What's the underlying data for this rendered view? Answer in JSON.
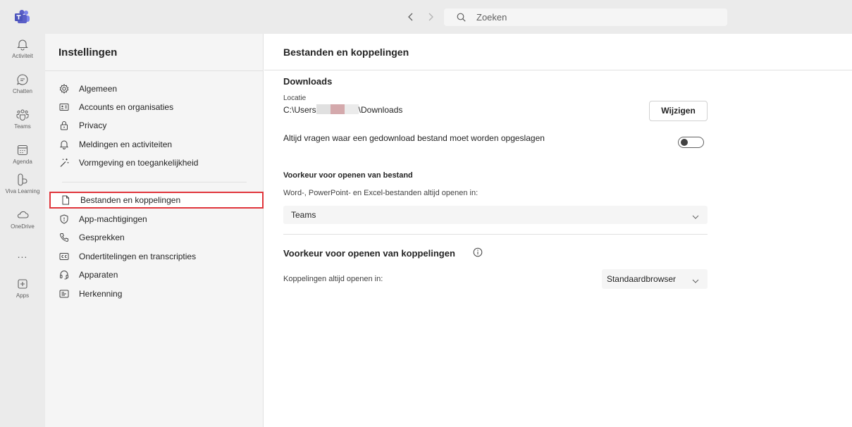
{
  "topbar": {
    "search_placeholder": "Zoeken"
  },
  "rail": {
    "items": [
      {
        "label": "Activiteit",
        "icon": "bell-icon"
      },
      {
        "label": "Chatten",
        "icon": "chat-icon"
      },
      {
        "label": "Teams",
        "icon": "teams-icon"
      },
      {
        "label": "Agenda",
        "icon": "calendar-icon"
      },
      {
        "label": "Viva Learning",
        "icon": "viva-learning-icon"
      },
      {
        "label": "OneDrive",
        "icon": "cloud-icon"
      },
      {
        "label": "Apps",
        "icon": "apps-plus-icon"
      }
    ],
    "more": "..."
  },
  "settings": {
    "title": "Instellingen",
    "items": [
      {
        "label": "Algemeen",
        "icon": "gear-icon"
      },
      {
        "label": "Accounts en organisaties",
        "icon": "account-card-icon"
      },
      {
        "label": "Privacy",
        "icon": "lock-icon"
      },
      {
        "label": "Meldingen en activiteiten",
        "icon": "bell-icon"
      },
      {
        "label": "Vormgeving en toegankelijkheid",
        "icon": "magic-wand-icon"
      },
      {
        "label": "Bestanden en koppelingen",
        "icon": "file-icon",
        "active": true
      },
      {
        "label": "App-machtigingen",
        "icon": "shield-icon"
      },
      {
        "label": "Gesprekken",
        "icon": "phone-icon"
      },
      {
        "label": "Ondertitelingen en transcripties",
        "icon": "closed-captions-icon"
      },
      {
        "label": "Apparaten",
        "icon": "headset-icon"
      },
      {
        "label": "Herkenning",
        "icon": "recognition-icon"
      }
    ]
  },
  "main": {
    "title": "Bestanden en koppelingen",
    "downloads": {
      "heading": "Downloads",
      "location_label": "Locatie",
      "path_prefix": "C:\\Users",
      "path_suffix": "\\Downloads",
      "change_button": "Wijzigen",
      "ask_label": "Altijd vragen waar een gedownload bestand moet worden opgeslagen",
      "ask_toggle_on": false
    },
    "file_pref": {
      "heading": "Voorkeur voor openen van bestand",
      "sub_label": "Word-, PowerPoint- en Excel-bestanden altijd openen in:",
      "selected": "Teams"
    },
    "link_pref": {
      "heading": "Voorkeur voor openen van koppelingen",
      "label": "Koppelingen altijd openen in:",
      "selected": "Standaardbrowser"
    }
  },
  "colors": {
    "active_outline": "#e0353b",
    "teams_brand": "#5b5fc7"
  }
}
